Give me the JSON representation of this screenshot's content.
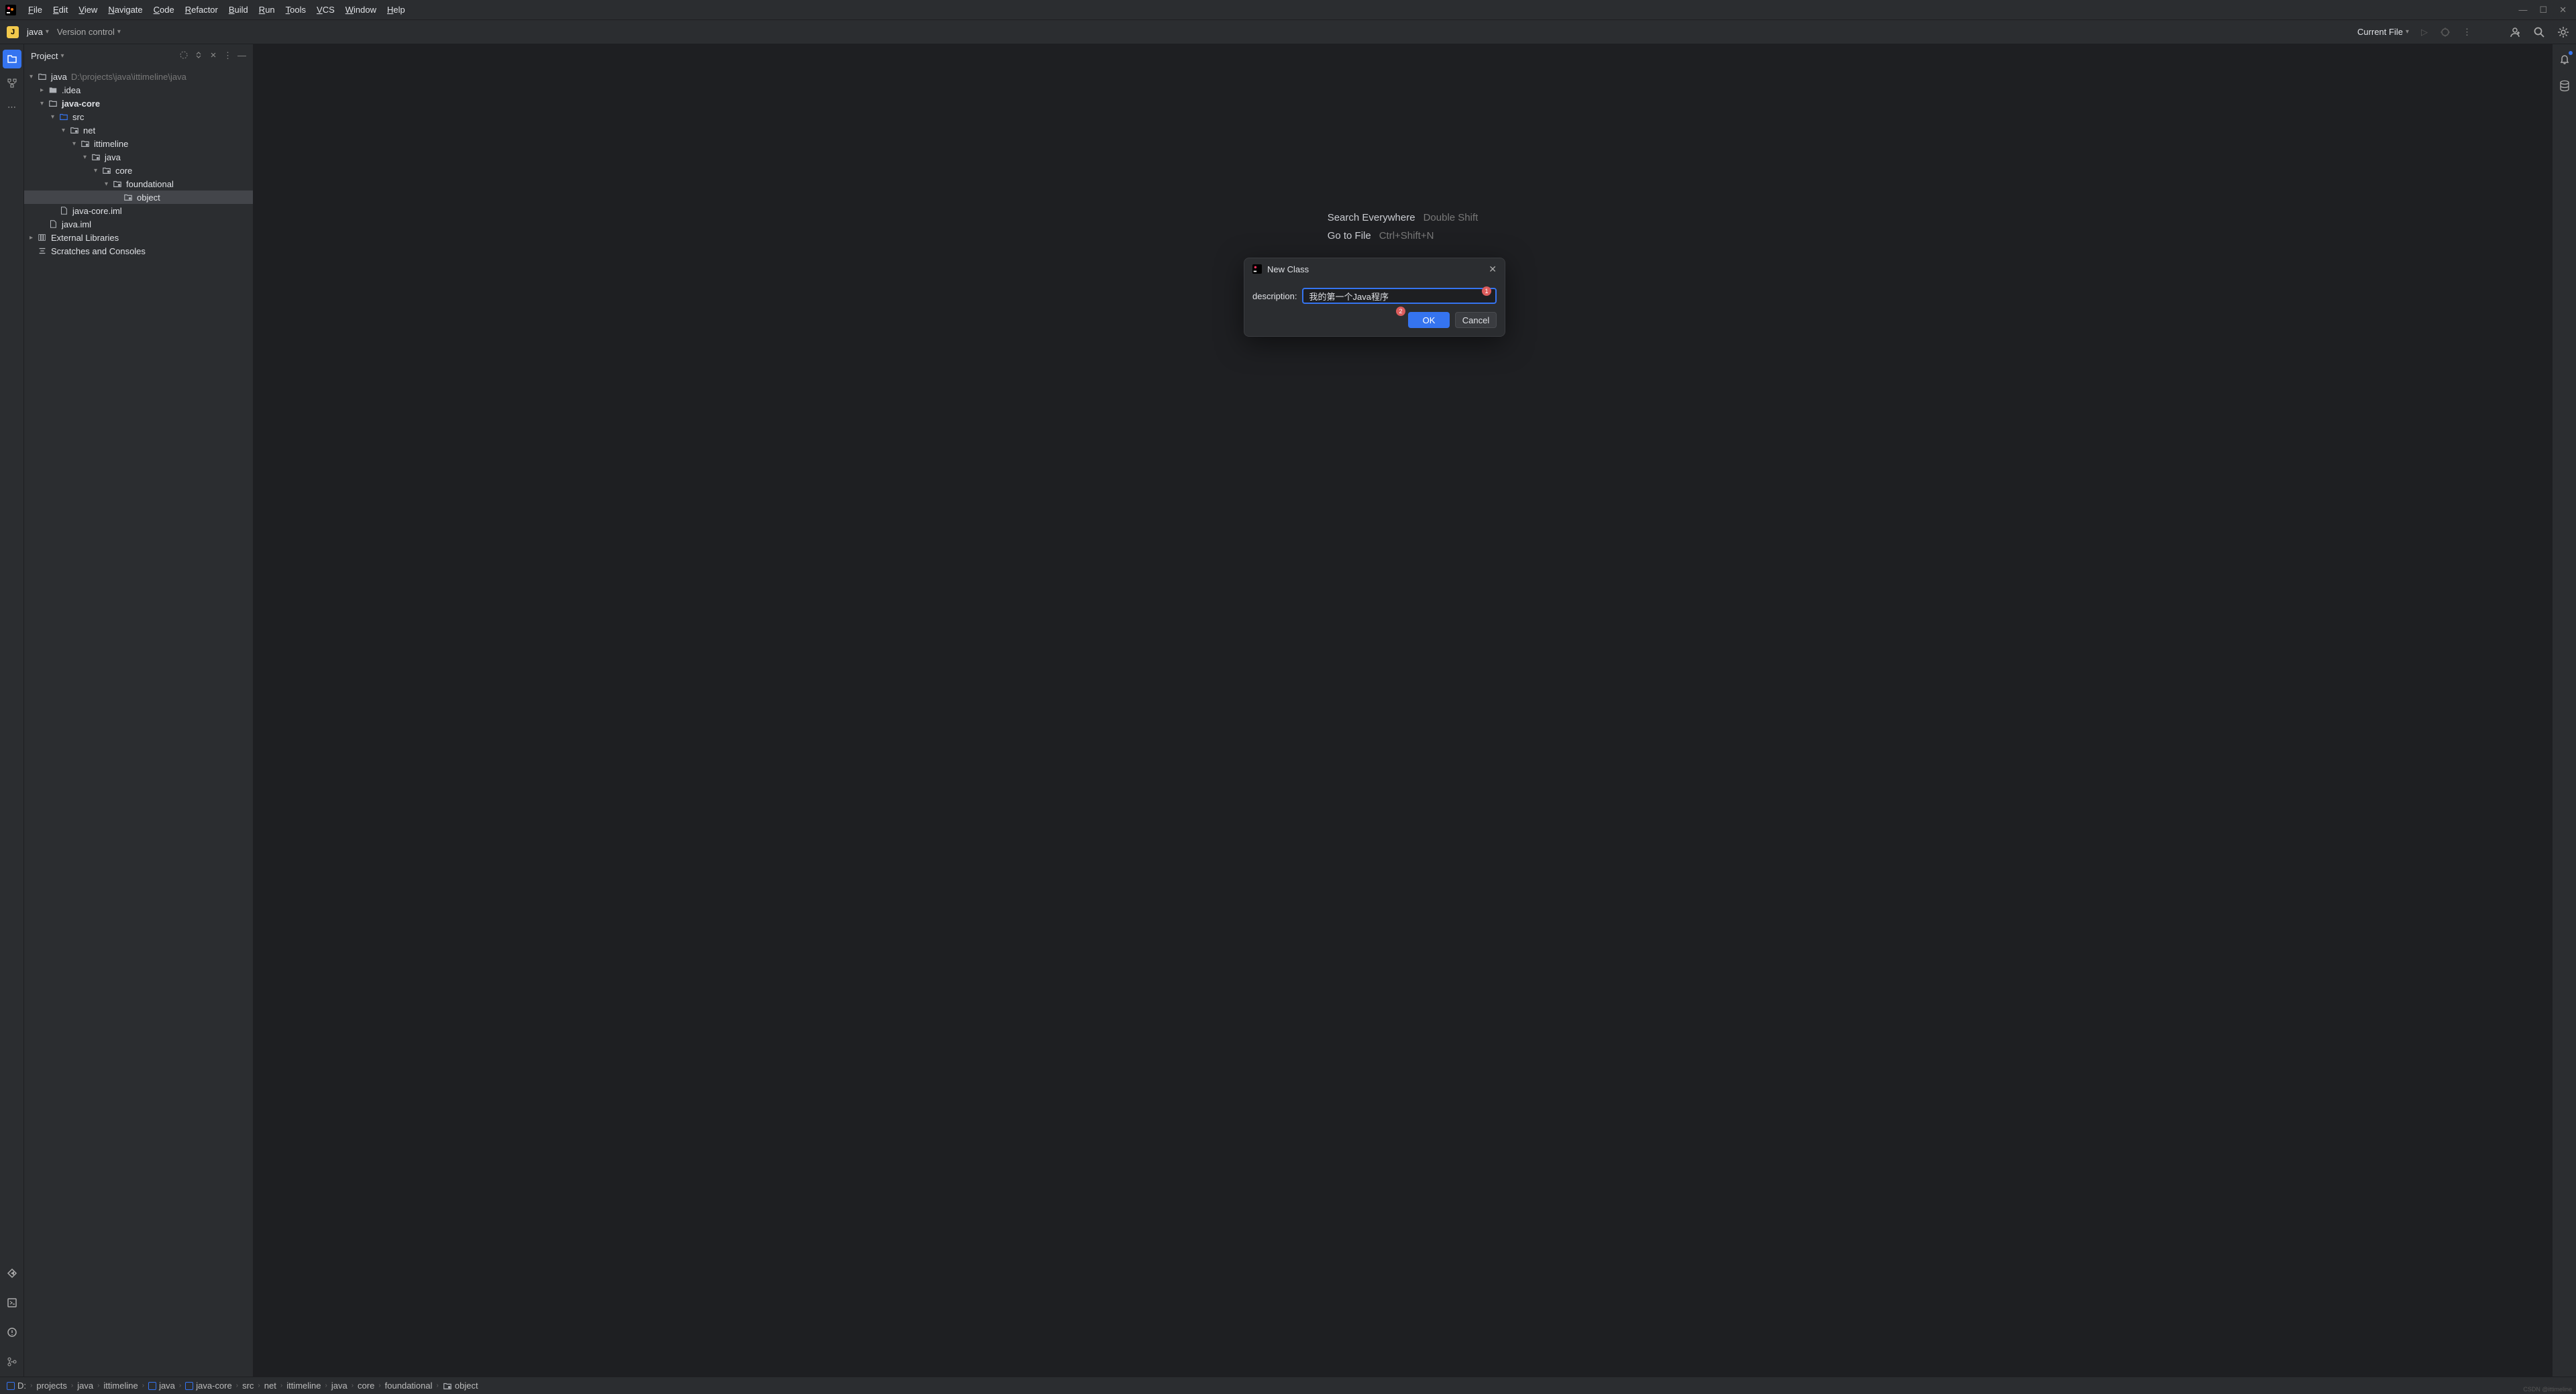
{
  "menubar": {
    "items": [
      "File",
      "Edit",
      "View",
      "Navigate",
      "Code",
      "Refactor",
      "Build",
      "Run",
      "Tools",
      "VCS",
      "Window",
      "Help"
    ]
  },
  "toolbar": {
    "project_badge": "J",
    "project_name": "java",
    "version_control": "Version control",
    "current_file": "Current File"
  },
  "sidebar": {
    "title": "Project",
    "tree": [
      {
        "depth": 0,
        "arrow": "down",
        "icon": "folder-open",
        "label": "java",
        "path": "D:\\projects\\java\\ittimeline\\java"
      },
      {
        "depth": 1,
        "arrow": "right",
        "icon": "folder",
        "label": ".idea"
      },
      {
        "depth": 1,
        "arrow": "down",
        "icon": "folder-open",
        "label": "java-core",
        "bold": true
      },
      {
        "depth": 2,
        "arrow": "down",
        "icon": "folder-blue",
        "label": "src"
      },
      {
        "depth": 3,
        "arrow": "down",
        "icon": "package",
        "label": "net"
      },
      {
        "depth": 4,
        "arrow": "down",
        "icon": "package",
        "label": "ittimeline"
      },
      {
        "depth": 5,
        "arrow": "down",
        "icon": "package",
        "label": "java"
      },
      {
        "depth": 6,
        "arrow": "down",
        "icon": "package",
        "label": "core"
      },
      {
        "depth": 7,
        "arrow": "down",
        "icon": "package",
        "label": "foundational"
      },
      {
        "depth": 8,
        "arrow": "none",
        "icon": "package",
        "label": "object",
        "selected": true
      },
      {
        "depth": 2,
        "arrow": "none",
        "icon": "file",
        "label": "java-core.iml"
      },
      {
        "depth": 1,
        "arrow": "none",
        "icon": "file",
        "label": "java.iml"
      },
      {
        "depth": 0,
        "arrow": "right",
        "icon": "library",
        "label": "External Libraries"
      },
      {
        "depth": 0,
        "arrow": "none",
        "icon": "scratch",
        "label": "Scratches and Consoles"
      }
    ]
  },
  "hints": [
    {
      "label": "Search Everywhere",
      "shortcut": "Double Shift"
    },
    {
      "label": "Go to File",
      "shortcut": "Ctrl+Shift+N"
    }
  ],
  "dialog": {
    "title": "New Class",
    "label": "description:",
    "value": "我的第一个Java程序",
    "ok": "OK",
    "cancel": "Cancel",
    "badge1": "1",
    "badge2": "2"
  },
  "breadcrumbs": [
    "D:",
    "projects",
    "java",
    "ittimeline",
    "java",
    "java-core",
    "src",
    "net",
    "ittimeline",
    "java",
    "core",
    "foundational",
    "object"
  ],
  "breadcrumb_icons": {
    "0": "square",
    "4": "square",
    "5": "square",
    "12": "package"
  },
  "watermark": "CSDN @ittimeline"
}
